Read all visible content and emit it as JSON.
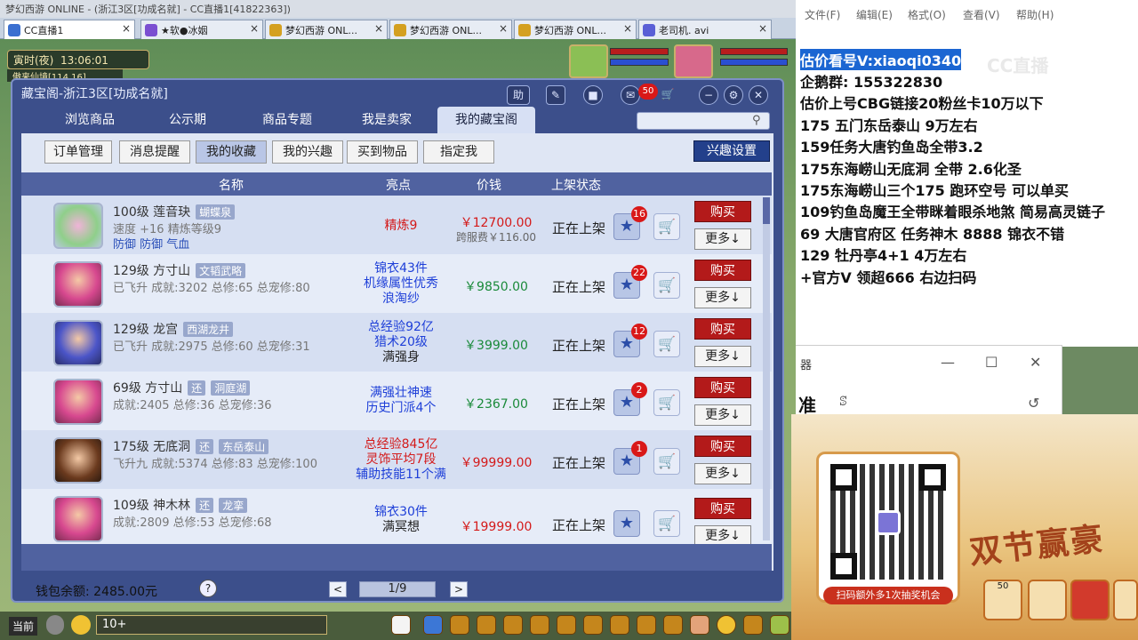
{
  "browser": {
    "window_title": "梦幻西游 ONLINE - (浙江3区[功成名就] - CC直播1[41822363])",
    "tabs": [
      {
        "label": "CC直播1"
      },
      {
        "label": "★软●冰姻"
      },
      {
        "label": "梦幻西游 ONL..."
      },
      {
        "label": "梦幻西游 ONL..."
      },
      {
        "label": "梦幻西游 ONL..."
      },
      {
        "label": "老司机. avi"
      }
    ]
  },
  "game": {
    "time_label": "寅时(夜)",
    "clock": "13:06:01",
    "location": "傲来仙境[114,16]",
    "bottom_label": "当前",
    "chat_value": "10+"
  },
  "dialog": {
    "title": "藏宝阁-浙江3区[功成名就]",
    "header_buttons": [
      "助",
      "✎",
      "■",
      "✉",
      "🛒"
    ],
    "message_count": "50",
    "main_tabs": [
      "浏览商品",
      "公示期",
      "商品专题",
      "我是卖家",
      "我的藏宝阁"
    ],
    "active_main_tab": 4,
    "sub_tabs": [
      "订单管理",
      "消息提醒",
      "我的收藏",
      "我的兴趣",
      "买到物品",
      "指定我"
    ],
    "active_sub_tab": 2,
    "interest_button": "兴趣设置",
    "columns": {
      "name": "名称",
      "highlight": "亮点",
      "price": "价钱",
      "status": "上架状态"
    },
    "buy_label": "购买",
    "more_label": "更多↓",
    "wallet": "钱包余额: 2485.00元",
    "help": "?",
    "page": "1/9",
    "prev": "<",
    "next": ">"
  },
  "items": [
    {
      "name": "100级 莲音玦",
      "tag": "蝴蝶泉",
      "line2": "速度 +16 精炼等级9",
      "line3": "防御 防御 气血",
      "highlight": [
        "精炼9"
      ],
      "highlight_color": "#d41a1a",
      "price": "￥12700.00",
      "fee": "跨服费￥116.00",
      "status": "正在上架",
      "favorites": "16"
    },
    {
      "name": "129级 方寸山",
      "tag": "文韬武略",
      "line2": "已飞升 成就:3202 总修:65 总宠修:80",
      "line3": "",
      "highlight": [
        "锦衣43件",
        "机缘属性优秀",
        "浪淘纱"
      ],
      "highlight_color": "#1e3fd8",
      "price": "￥9850.00",
      "fee": "",
      "status": "正在上架",
      "favorites": "22"
    },
    {
      "name": "129级 龙宫",
      "tag": "西湖龙井",
      "line2": "已飞升 成就:2975 总修:60 总宠修:31",
      "line3": "",
      "highlight": [
        "总经验92亿",
        "猎术20级",
        "满强身"
      ],
      "highlight_color": "#1e3fd8",
      "price": "￥3999.00",
      "fee": "",
      "status": "正在上架",
      "favorites": "12"
    },
    {
      "name": "69级 方寸山",
      "tag": "还",
      "tag2": "洞庭湖",
      "line2": "成就:2405 总修:36 总宠修:36",
      "line3": "",
      "highlight": [
        "满强壮神速",
        "历史门派4个"
      ],
      "highlight_color": "#1e3fd8",
      "price": "￥2367.00",
      "fee": "",
      "status": "正在上架",
      "favorites": "2"
    },
    {
      "name": "175级 无底洞",
      "tag": "还",
      "tag2": "东岳泰山",
      "line2": "飞升九 成就:5374 总修:83 总宠修:100",
      "line3": "",
      "highlight": [
        "总经验845亿",
        "灵饰平均7段",
        "辅助技能11个满"
      ],
      "highlight_color": "#d41a1a",
      "price": "￥99999.00",
      "fee": "",
      "status": "正在上架",
      "favorites": "1"
    },
    {
      "name": "109级 神木林",
      "tag": "还",
      "tag2": "龙挛",
      "line2": "成就:2809 总修:53 总宠修:68",
      "line3": "",
      "highlight": [
        "锦衣30件",
        "满冥想"
      ],
      "highlight_color": "#1e3fd8",
      "price": "￥19999.00",
      "fee": "",
      "status": "正在上架",
      "favorites": ""
    }
  ],
  "notepad": {
    "menus": [
      "文件(F)",
      "编辑(E)",
      "格式(O)",
      "查看(V)",
      "帮助(H)"
    ],
    "lines": [
      "估价看号V:xiaoqi0340",
      "企鹅群: 155322830",
      "估价上号CBG链接20粉丝卡10万以下",
      "175 五门东岳泰山  9万左右",
      "159任务大唐钓鱼岛全带3.2",
      "175东海崂山无底洞  全带  2.6化圣",
      "175东海崂山三个175 跑环空号 可以单买",
      "109钓鱼岛魔王全带眯着眼杀地煞 简易高灵链子",
      "69  大唐官府区 任务神木 8888 锦衣不错",
      "129 牡丹亭4+1 4万左右",
      "+官方V 领超666 右边扫码"
    ],
    "overlay_logo": "CC直播"
  },
  "sub_window": {
    "title": "器",
    "text": "准"
  },
  "promo": {
    "caption": "扫码额外多1次抽奖机会",
    "title": "双节赢豪",
    "items": [
      "50",
      "",
      ""
    ]
  }
}
